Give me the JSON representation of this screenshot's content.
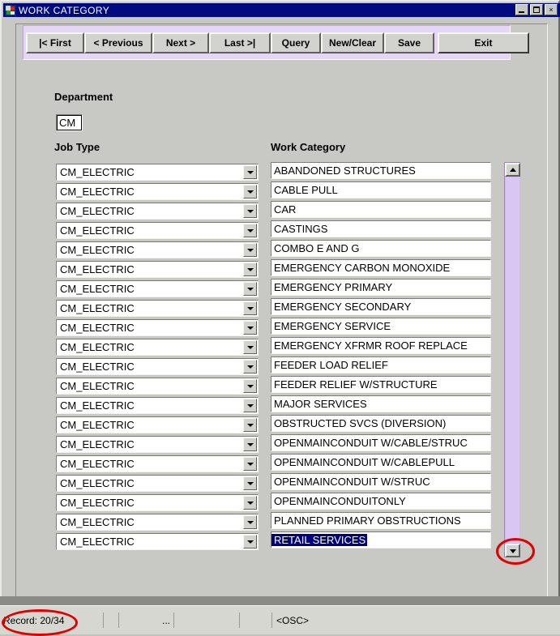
{
  "window": {
    "title": "WORK CATEGORY",
    "icon": "application-icon",
    "controls": {
      "minimize": "minimize-icon",
      "maximize": "maximize-icon",
      "close": "×"
    }
  },
  "toolbar": {
    "buttons": [
      {
        "label": "|< First",
        "name": "first-button"
      },
      {
        "label": "< Previous",
        "name": "previous-button"
      },
      {
        "label": "Next >",
        "name": "next-button"
      },
      {
        "label": "Last >|",
        "name": "last-button"
      },
      {
        "label": "Query",
        "name": "query-button"
      },
      {
        "label": "New/Clear",
        "name": "new-clear-button"
      },
      {
        "label": "Save",
        "name": "save-button"
      },
      {
        "label": "Exit",
        "name": "exit-button"
      }
    ]
  },
  "form": {
    "department_label": "Department",
    "department_value": "CM",
    "jobtype_label": "Job Type",
    "workcategory_label": "Work Category"
  },
  "rows": [
    {
      "job_type": "CM_ELECTRIC",
      "work_category": "ABANDONED STRUCTURES",
      "selected": false
    },
    {
      "job_type": "CM_ELECTRIC",
      "work_category": "CABLE PULL",
      "selected": false
    },
    {
      "job_type": "CM_ELECTRIC",
      "work_category": "CAR",
      "selected": false
    },
    {
      "job_type": "CM_ELECTRIC",
      "work_category": "CASTINGS",
      "selected": false
    },
    {
      "job_type": "CM_ELECTRIC",
      "work_category": "COMBO E AND G",
      "selected": false
    },
    {
      "job_type": "CM_ELECTRIC",
      "work_category": "EMERGENCY CARBON MONOXIDE",
      "selected": false
    },
    {
      "job_type": "CM_ELECTRIC",
      "work_category": "EMERGENCY PRIMARY",
      "selected": false
    },
    {
      "job_type": "CM_ELECTRIC",
      "work_category": "EMERGENCY SECONDARY",
      "selected": false
    },
    {
      "job_type": "CM_ELECTRIC",
      "work_category": "EMERGENCY SERVICE",
      "selected": false
    },
    {
      "job_type": "CM_ELECTRIC",
      "work_category": "EMERGENCY XFRMR ROOF REPLACE",
      "selected": false
    },
    {
      "job_type": "CM_ELECTRIC",
      "work_category": "FEEDER LOAD RELIEF",
      "selected": false
    },
    {
      "job_type": "CM_ELECTRIC",
      "work_category": "FEEDER RELIEF W/STRUCTURE",
      "selected": false
    },
    {
      "job_type": "CM_ELECTRIC",
      "work_category": "MAJOR SERVICES",
      "selected": false
    },
    {
      "job_type": "CM_ELECTRIC",
      "work_category": "OBSTRUCTED SVCS (DIVERSION)",
      "selected": false
    },
    {
      "job_type": "CM_ELECTRIC",
      "work_category": "OPENMAINCONDUIT W/CABLE/STRUC",
      "selected": false
    },
    {
      "job_type": "CM_ELECTRIC",
      "work_category": "OPENMAINCONDUIT W/CABLEPULL",
      "selected": false
    },
    {
      "job_type": "CM_ELECTRIC",
      "work_category": "OPENMAINCONDUIT W/STRUC",
      "selected": false
    },
    {
      "job_type": "CM_ELECTRIC",
      "work_category": "OPENMAINCONDUITONLY",
      "selected": false
    },
    {
      "job_type": "CM_ELECTRIC",
      "work_category": "PLANNED PRIMARY OBSTRUCTIONS",
      "selected": false
    },
    {
      "job_type": "CM_ELECTRIC",
      "work_category": "RETAIL SERVICES",
      "selected": true
    }
  ],
  "scrollbar": {
    "up_icon": "scroll-up-arrow-icon",
    "down_icon": "scroll-down-arrow-icon",
    "track_color": "#d9c6f2"
  },
  "status_bar": {
    "record": "Record: 20/34",
    "gap1": "",
    "mode": "...",
    "gap2": "",
    "gap3": "",
    "osc": "<OSC>"
  },
  "annotations": {
    "color": "#e10000",
    "highlight_record": "Record: 20/34",
    "highlight_scroll": "scroll-down-arrow-icon"
  },
  "colors": {
    "titlebar": "#000b7f",
    "toolbar_panel": "#e6d6f5",
    "selection": "#00007d",
    "face": "#c8c8c4"
  }
}
